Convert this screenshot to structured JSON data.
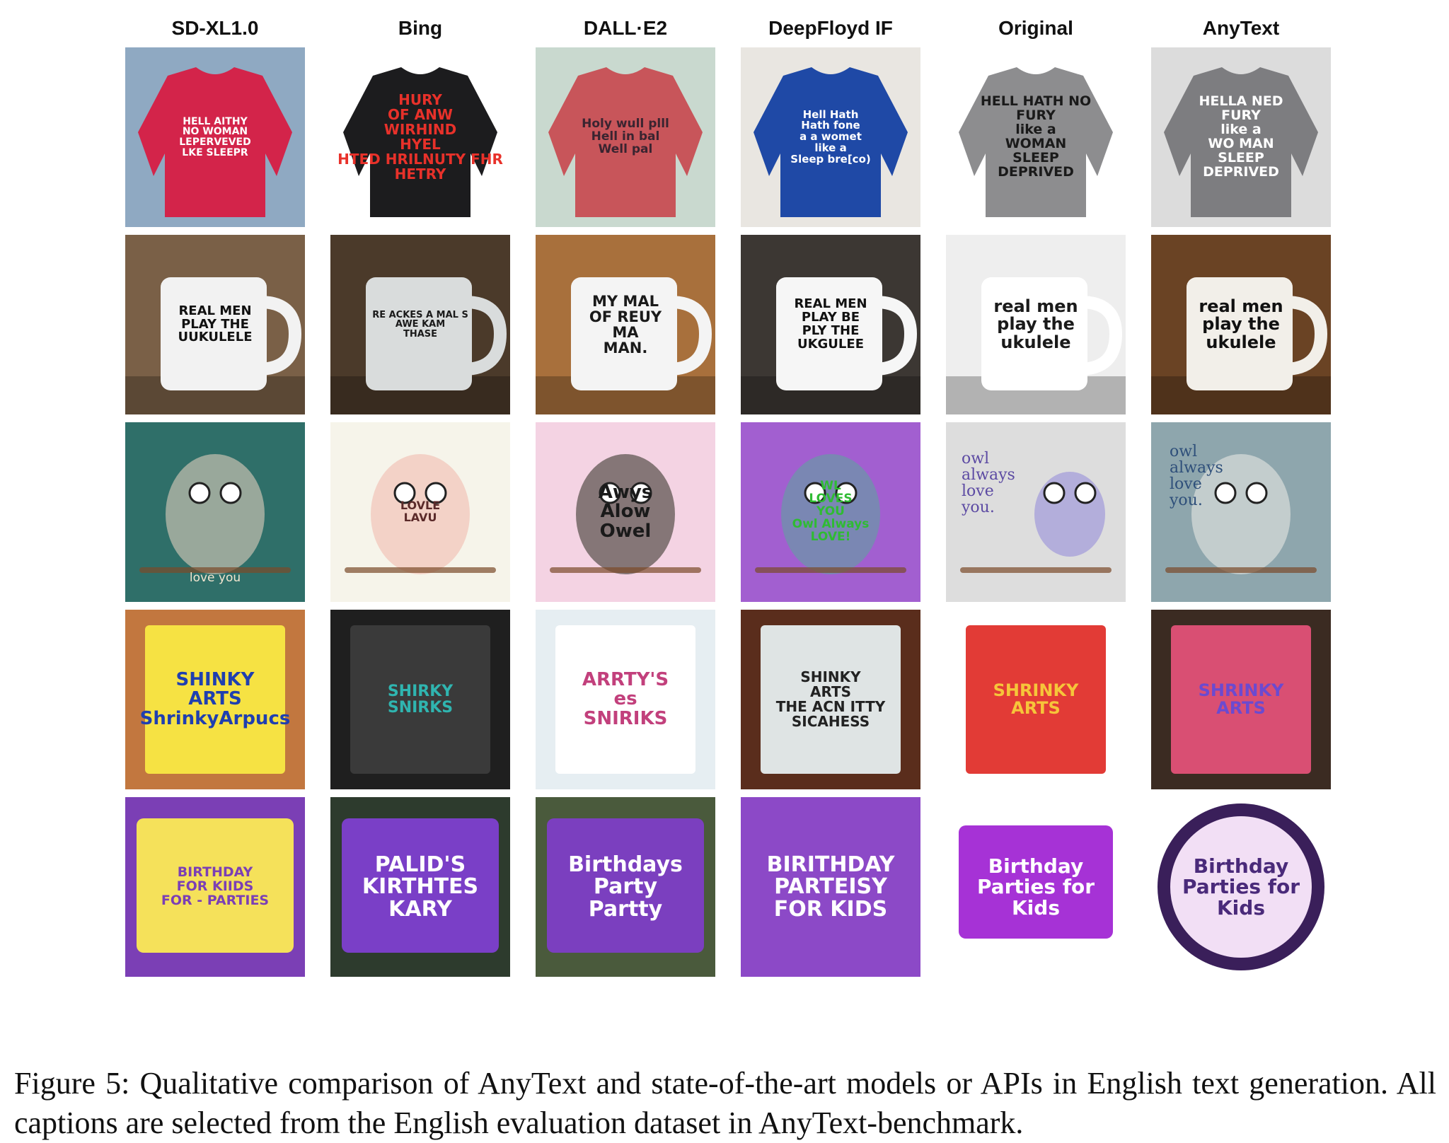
{
  "columns": [
    "SD-XL1.0",
    "Bing",
    "DALL·E2",
    "DeepFloyd IF",
    "Original",
    "AnyText"
  ],
  "rows": [
    {
      "subject": "sweatshirt",
      "tiles": [
        {
          "text": "HELL AITHY\nNO WOMAN\nLEPERVEVED\nLKE SLEEPR",
          "bg": "#8fa9c2",
          "fg": "#ffffff",
          "obj": "#d3244a",
          "size": 14
        },
        {
          "text": "HURY\nOF ANW\nWIRHIND\nHYEL\nHTED HRILNUTY FHR\nHETRY",
          "bg": "#ffffff",
          "fg": "#e8312a",
          "obj": "#1c1c1e",
          "size": 20
        },
        {
          "text": "Holy wull plll\nHell in bal\nWell pal",
          "bg": "#c9d9cf",
          "fg": "#3a2430",
          "obj": "#c8555a",
          "size": 17
        },
        {
          "text": "Hell Hath\nHath fone\na a womet\nlike a\nSleep bre[co)",
          "bg": "#e9e6e1",
          "fg": "#ffffff",
          "obj": "#1f49a6",
          "size": 15
        },
        {
          "text": "HELL HATH NO\nFURY\nlike a\nWOMAN\nSLEEP\nDEPRIVED",
          "bg": "#ffffff",
          "fg": "#1a1a1a",
          "obj": "#8d8d8f",
          "size": 19
        },
        {
          "text": "HELLA NED\nFURY\nlike a\nWO MAN\nSLEEP\nDEPRIVED",
          "bg": "#dcdcdc",
          "fg": "#ffffff",
          "obj": "#7d7d80",
          "size": 19
        }
      ]
    },
    {
      "subject": "mug",
      "tiles": [
        {
          "text": "REAL MEN\nPLAY THE\nUUKULELE",
          "bg": "#7a6047",
          "fg": "#111111",
          "obj": "#f2f2f2",
          "size": 18
        },
        {
          "text": "RE ACKES A MAL S\nAWE  KAM\nTHASE",
          "bg": "#4b3a2a",
          "fg": "#1a1a1a",
          "obj": "#d9dcdc",
          "size": 13
        },
        {
          "text": "MY MAL\nOF REUY\nMA\nMAN.",
          "bg": "#a8703c",
          "fg": "#1a1a1a",
          "obj": "#f4f4f4",
          "size": 21
        },
        {
          "text": "REAL MEN\nPLAY BE\nPLY THE\nUKGULEE",
          "bg": "#3c3733",
          "fg": "#111111",
          "obj": "#f6f6f6",
          "size": 18
        },
        {
          "text": "real men\nplay the\nukulele",
          "bg": "#eeeeee",
          "fg": "#1a1a1a",
          "obj": "#ffffff",
          "size": 24
        },
        {
          "text": "real men\nplay the\nukulele",
          "bg": "#6a4324",
          "fg": "#111111",
          "obj": "#f2efe9",
          "size": 24
        }
      ]
    },
    {
      "subject": "owl",
      "tiles": [
        {
          "text": "love you",
          "bg": "#2f6f69",
          "fg": "#f3e6d0",
          "obj": "#f0d7c4",
          "size": 17
        },
        {
          "text": "LOVLE\nLAVU",
          "bg": "#f6f4ea",
          "fg": "#5b2a2a",
          "obj": "#f0b7aa",
          "size": 16
        },
        {
          "text": "Awys\nAlow\nOwel",
          "bg": "#f4d3e3",
          "fg": "#1a1a1a",
          "obj": "#2a2a1f",
          "size": 26
        },
        {
          "text": "WL\nLOVES\nYOU\nOwl Always\nLOVE!",
          "bg": "#a25fd0",
          "fg": "#2fbb33",
          "obj": "#5aa89b",
          "size": 17
        },
        {
          "text": "owl\nalways\nlove\nyou.",
          "bg": "#dddddd",
          "fg": "#5c4aa3",
          "obj": "#8f86d8",
          "size": 22
        },
        {
          "text": "owl\nalways\nlove\nyou.",
          "bg": "#8ea6ad",
          "fg": "#2e4f7a",
          "obj": "#efece7",
          "size": 22
        }
      ]
    },
    {
      "subject": "book",
      "tiles": [
        {
          "text": "SHINKY\nARTS\nShrinkyArpucs",
          "bg": "#c2773f",
          "fg": "#1f3fb0",
          "obj": "#f6e243",
          "size": 26
        },
        {
          "text": "SHIRKY\nSNIRKS",
          "bg": "#1f1f1f",
          "fg": "#2fb5b0",
          "obj": "#3a3a3a",
          "size": 22
        },
        {
          "text": "ARRTY'S\nes\nSNIRIKS",
          "bg": "#e6eef2",
          "fg": "#c2407c",
          "obj": "#ffffff",
          "size": 26
        },
        {
          "text": "SHINKY\nARTS\nTHE ACN ITTY SICAHESS",
          "bg": "#5a2d1c",
          "fg": "#222222",
          "obj": "#dfe4e4",
          "size": 20
        },
        {
          "text": "SHRINKY\nARTS",
          "bg": "#ffffff",
          "fg": "#f6c53a",
          "obj": "#e23b36",
          "size": 24
        },
        {
          "text": "SHRINKY\nARTS",
          "bg": "#3b2b22",
          "fg": "#6b4ad0",
          "obj": "#d94f73",
          "size": 24
        }
      ]
    },
    {
      "subject": "sign",
      "tiles": [
        {
          "text": "BIRTHDAY\nFOR KIIDS\nFOR - PARTIES",
          "bg": "#7b3fb5",
          "fg": "#7b3fb5",
          "obj": "#f5e15a",
          "size": 19
        },
        {
          "text": "PALID'S\nKIRTHTES\nKARY",
          "bg": "#2d3b2d",
          "fg": "#ffffff",
          "obj": "#7a3fc7",
          "size": 30
        },
        {
          "text": "Birthdays\nParty\nPartty",
          "bg": "#4a5a3c",
          "fg": "#ffffff",
          "obj": "#7b3fbf",
          "size": 30
        },
        {
          "text": "BIRITHDAY\nPARTEISY\nFOR KIDS",
          "bg": "#8c49c7",
          "fg": "#ffffff",
          "obj": "#8c49c7",
          "size": 30
        },
        {
          "text": "Birthday\nParties for\nKids",
          "bg": "#ffffff",
          "fg": "#ffffff",
          "obj": "#a632d6",
          "size": 28
        },
        {
          "text": "Birthday\nParties for\nKids",
          "bg": "#ffffff",
          "fg": "#4a2a7a",
          "obj": "#f2dff5",
          "size": 28
        }
      ]
    }
  ],
  "caption": "Figure 5: Qualitative comparison of AnyText and state-of-the-art models or APIs in English text generation. All captions are selected from the English evaluation dataset in AnyText-benchmark."
}
